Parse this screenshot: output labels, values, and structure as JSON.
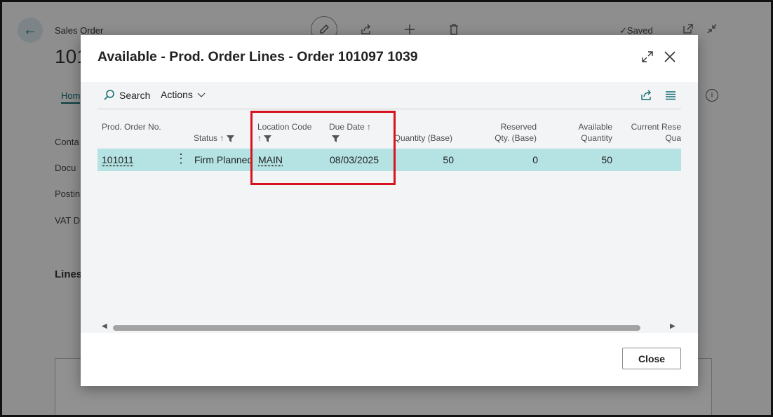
{
  "background": {
    "page_caption": "Sales Order",
    "order_number_partial": "101",
    "saved_label": "✓Saved",
    "home_tab_partial": "Hom",
    "field_labels": [
      "Conta",
      "Docu",
      "Postin",
      "VAT D"
    ],
    "lines_label": "Lines",
    "back_glyph": "←"
  },
  "dialog": {
    "title": "Available - Prod. Order Lines - Order 101097 1039",
    "search_label": "Search",
    "actions_label": "Actions",
    "close_button": "Close"
  },
  "columns": {
    "prod_order_no": "Prod. Order No.",
    "status": "Status",
    "location_code": "Location Code",
    "due_date": "Due Date",
    "quantity_base": "Quantity (Base)",
    "reserved_qty": "Reserved Qty. (Base)",
    "available_qty": "Available Quantity",
    "current_reserved": "Current Rese Qua"
  },
  "rows": [
    {
      "prod_order_no": "101011",
      "status": "Firm Planned",
      "location_code": "MAIN",
      "due_date": "08/03/2025",
      "quantity_base": "50",
      "reserved_qty": "0",
      "available_qty": "50"
    }
  ],
  "icons": [
    "back-arrow-icon",
    "search-icon",
    "chevron-down-icon",
    "share-icon",
    "list-icon",
    "expand-icon",
    "close-icon",
    "filter-icon",
    "sort-ascending-icon",
    "more-options-icon"
  ],
  "colors": {
    "accent": "#0f6d73",
    "selected_row": "#b5e3e3",
    "highlight_box": "#d6141f"
  }
}
